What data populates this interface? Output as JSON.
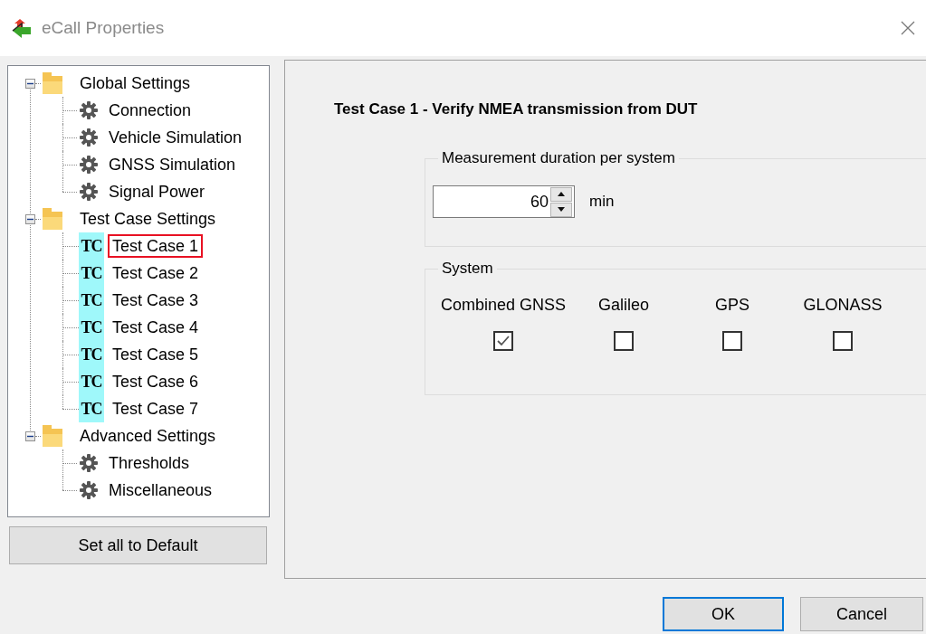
{
  "window": {
    "title": "eCall Properties"
  },
  "tree": [
    {
      "label": "Global Settings",
      "kind": "folder",
      "expanded": true,
      "children": [
        {
          "label": "Connection",
          "kind": "gear",
          "selected": false
        },
        {
          "label": "Vehicle Simulation",
          "kind": "gear",
          "selected": false
        },
        {
          "label": "GNSS Simulation",
          "kind": "gear",
          "selected": false
        },
        {
          "label": "Signal Power",
          "kind": "gear",
          "selected": false
        }
      ]
    },
    {
      "label": "Test Case Settings",
      "kind": "folder",
      "expanded": true,
      "children": [
        {
          "label": "Test Case 1",
          "kind": "tc",
          "badge": "TC",
          "selected": true
        },
        {
          "label": "Test Case 2",
          "kind": "tc",
          "badge": "TC",
          "selected": false
        },
        {
          "label": "Test Case 3",
          "kind": "tc",
          "badge": "TC",
          "selected": false
        },
        {
          "label": "Test Case 4",
          "kind": "tc",
          "badge": "TC",
          "selected": false
        },
        {
          "label": "Test Case 5",
          "kind": "tc",
          "badge": "TC",
          "selected": false
        },
        {
          "label": "Test Case 6",
          "kind": "tc",
          "badge": "TC",
          "selected": false
        },
        {
          "label": "Test Case 7",
          "kind": "tc",
          "badge": "TC",
          "selected": false
        }
      ]
    },
    {
      "label": "Advanced Settings",
      "kind": "folder",
      "expanded": true,
      "children": [
        {
          "label": "Thresholds",
          "kind": "gear",
          "selected": false
        },
        {
          "label": "Miscellaneous",
          "kind": "gear",
          "selected": false
        }
      ]
    }
  ],
  "default_button": "Set all to Default",
  "heading": "Test Case 1 - Verify NMEA transmission from DUT",
  "duration_group": {
    "title": "Measurement duration per system",
    "value": "60",
    "unit": "min"
  },
  "system_group": {
    "title": "System",
    "systems": [
      {
        "label": "Combined GNSS",
        "checked": true
      },
      {
        "label": "Galileo",
        "checked": false
      },
      {
        "label": "GPS",
        "checked": false
      },
      {
        "label": "GLONASS",
        "checked": false
      }
    ]
  },
  "buttons": [
    {
      "label": "OK",
      "default": true
    },
    {
      "label": "Cancel",
      "default": false
    }
  ]
}
